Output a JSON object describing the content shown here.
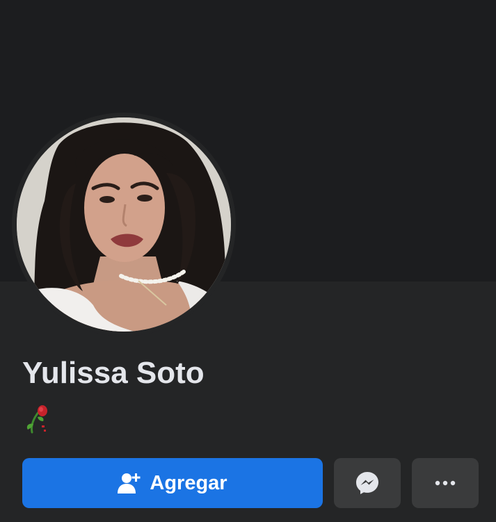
{
  "profile": {
    "name": "Yulissa Soto",
    "bio_emoji": "wilted-rose-emoji"
  },
  "actions": {
    "add_friend_label": "Agregar",
    "add_friend_icon": "add-friend-icon",
    "message_icon": "messenger-icon",
    "more_icon": "more-dots-icon"
  },
  "colors": {
    "background": "#242526",
    "cover": "#1c1d1f",
    "primary_button": "#1b74e4",
    "secondary_button": "#3a3b3c",
    "name_text": "#e4e6eb"
  }
}
